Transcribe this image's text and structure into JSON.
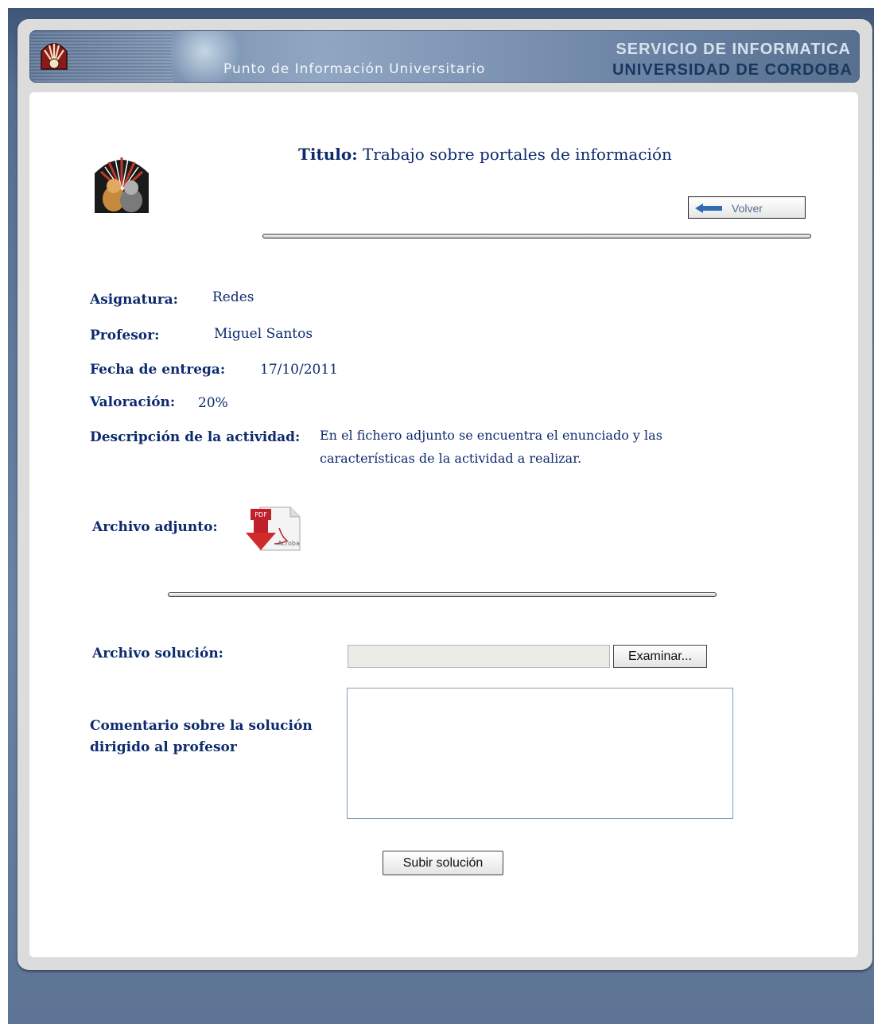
{
  "header": {
    "subtitle": "Punto de Información Universitario",
    "service": "SERVICIO DE INFORMATICA",
    "university": "UNIVERSIDAD DE CORDOBA",
    "logo_icon": "university-crest-icon"
  },
  "activity": {
    "title_label": "Titulo:",
    "title_value": "Trabajo sobre portales de información",
    "back_label": "Volver",
    "fields": [
      {
        "label": "Asignatura:",
        "value": "Redes"
      },
      {
        "label": "Profesor:",
        "value": "Miguel Santos"
      },
      {
        "label": "Fecha de entrega:",
        "value": "17/10/2011"
      },
      {
        "label": "Valoración:",
        "value": "20%"
      }
    ],
    "description_label": "Descripción de la actividad:",
    "description_line1": "En el fichero adjunto se encuentra el enunciado y las",
    "description_line2": "características de la actividad a realizar.",
    "attachment_label": "Archivo adjunto:",
    "attachment_icon": "pdf-download-icon",
    "attachment_icon_text1": "PDF",
    "attachment_icon_text2": "Acroba"
  },
  "solution": {
    "file_label": "Archivo solución:",
    "browse_label": "Examinar...",
    "file_value": "",
    "comment_label_line1": "Comentario sobre la solución",
    "comment_label_line2": "dirigido al profesor",
    "comment_value": "",
    "submit_label": "Subir solución"
  },
  "colors": {
    "text_blue": "#0d2a6e",
    "frame": "#556d91",
    "panel": "#dcdcdc"
  }
}
